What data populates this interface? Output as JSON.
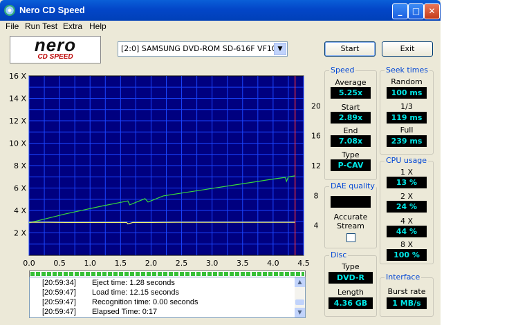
{
  "window": {
    "title": "Nero CD Speed",
    "min": "_",
    "max": "□",
    "close": "✕"
  },
  "menu": [
    "File",
    "Run Test",
    "Extra",
    "Help"
  ],
  "logo": {
    "line1": "nero",
    "line2": "CD SPEED"
  },
  "drive": {
    "selected": "[2:0]   SAMSUNG DVD-ROM SD-616F VF100"
  },
  "buttons": {
    "start": "Start",
    "exit": "Exit"
  },
  "speed": {
    "label": "Speed",
    "average_label": "Average",
    "average": "5.25x",
    "start_label": "Start",
    "start": "2.89x",
    "end_label": "End",
    "end": "7.08x",
    "type_label": "Type",
    "type": "P-CAV"
  },
  "seek": {
    "label": "Seek times",
    "random_label": "Random",
    "random": "100 ms",
    "third_label": "1/3",
    "third": "119 ms",
    "full_label": "Full",
    "full": "239 ms"
  },
  "cpu": {
    "label": "CPU usage",
    "items": [
      {
        "label": "1 X",
        "value": "13 %"
      },
      {
        "label": "2 X",
        "value": "24 %"
      },
      {
        "label": "4 X",
        "value": "44 %"
      },
      {
        "label": "8 X",
        "value": "100 %"
      }
    ]
  },
  "dae": {
    "label": "DAE quality",
    "accurate_label": "Accurate",
    "stream_label": "Stream",
    "value": ""
  },
  "disc": {
    "label": "Disc",
    "type_label": "Type",
    "type": "DVD-R",
    "length_label": "Length",
    "length": "4.36 GB"
  },
  "interface": {
    "label": "Interface",
    "burst_label": "Burst rate",
    "burst": "1 MB/s"
  },
  "progress": {
    "fraction": 1.0
  },
  "log": [
    {
      "time": "[20:59:34]",
      "msg": "Eject time: 1.28 seconds"
    },
    {
      "time": "[20:59:47]",
      "msg": "Load time: 12.15 seconds"
    },
    {
      "time": "[20:59:47]",
      "msg": "Recognition time: 0.00 seconds"
    },
    {
      "time": "[20:59:47]",
      "msg": "Elapsed Time:  0:17"
    }
  ],
  "colors": {
    "plot_bg": "#000080",
    "grid": "#1a44ff",
    "read_speed": "#39d83a",
    "rpm": "#f2f270",
    "marker": "#ff3030",
    "value_text": "#00e8e8"
  },
  "chart_data": {
    "type": "line",
    "xlim": [
      0.0,
      4.5
    ],
    "x_ticks": [
      "0.0",
      "0.5",
      "1.0",
      "1.5",
      "2.0",
      "2.5",
      "3.0",
      "3.5",
      "4.0",
      "4.5"
    ],
    "ylim": [
      0,
      16
    ],
    "y_ticks": [
      "2 X",
      "4 X",
      "6 X",
      "8 X",
      "10 X",
      "12 X",
      "14 X",
      "16 X"
    ],
    "y2lim": [
      0,
      24
    ],
    "y2_ticks": [
      "4",
      "8",
      "12",
      "16",
      "20"
    ],
    "grid": true,
    "end_marker_x": 4.36,
    "series": [
      {
        "color": "#39d83a",
        "x": [
          0.0,
          0.3,
          0.6,
          0.9,
          1.2,
          1.5,
          1.62,
          1.65,
          1.9,
          1.95,
          2.2,
          2.5,
          2.8,
          3.1,
          3.4,
          3.7,
          4.0,
          4.2,
          4.22,
          4.25,
          4.36
        ],
        "y": [
          2.89,
          3.3,
          3.7,
          4.05,
          4.4,
          4.72,
          4.85,
          4.5,
          5.05,
          4.75,
          5.3,
          5.55,
          5.8,
          6.05,
          6.3,
          6.55,
          6.8,
          6.95,
          6.6,
          7.0,
          7.08
        ]
      },
      {
        "color": "#f2f270",
        "x": [
          0.0,
          0.3,
          0.6,
          1.0,
          1.4,
          1.6,
          1.62,
          1.7,
          2.0,
          2.5,
          3.0,
          3.5,
          4.0,
          4.36
        ],
        "y": [
          2.95,
          2.95,
          2.93,
          2.93,
          2.93,
          2.93,
          2.8,
          2.93,
          2.93,
          2.95,
          2.95,
          2.95,
          2.95,
          2.95
        ]
      }
    ]
  }
}
